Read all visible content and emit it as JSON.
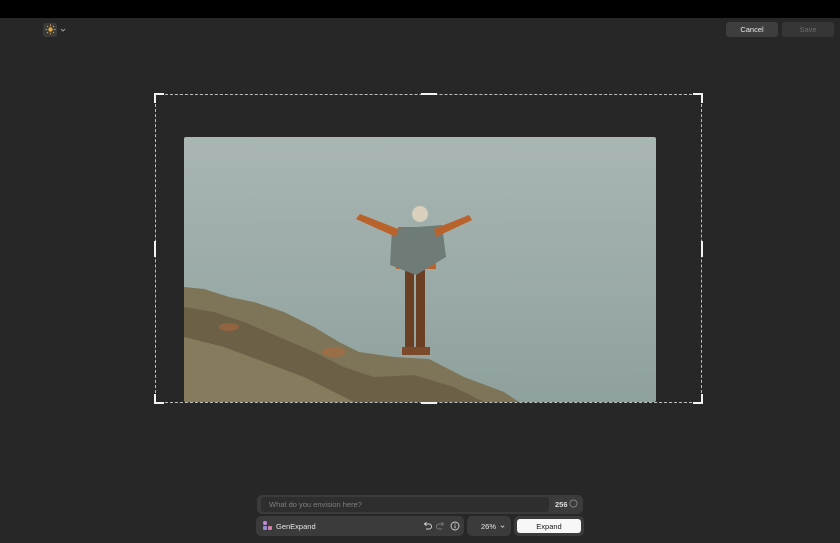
{
  "header": {
    "app_icon": "sun-icon",
    "cancel_label": "Cancel",
    "save_label": "Save"
  },
  "prompt": {
    "placeholder": "What do you envision here?",
    "char_count": "256"
  },
  "toolbar": {
    "tool_name": "GenExpand",
    "tool_icon": "genexpand-icon",
    "undo_icon": "undo-icon",
    "redo_icon": "redo-icon",
    "info_icon": "info-icon",
    "zoom": "26%",
    "expand_label": "Expand"
  },
  "colors": {
    "background": "#272727",
    "panel": "#3b3b3b",
    "accent_sun": "#e0a83a"
  }
}
